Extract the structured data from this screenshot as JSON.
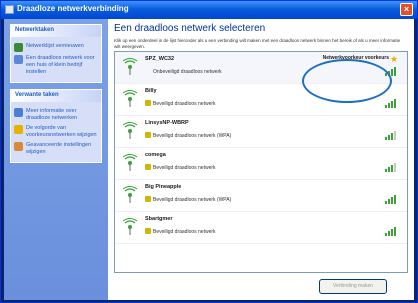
{
  "window": {
    "title": "Draadloze netwerkverbinding",
    "close_label": "×"
  },
  "sidebar": {
    "sections": [
      {
        "heading": "Netwerktaken",
        "items": [
          {
            "label": "Netwerklijst vernieuwen",
            "icon": "refresh-icon"
          },
          {
            "label": "Een draadloos netwerk voor een huis of klein bedrijf instellen",
            "icon": "setup-wireless-icon"
          }
        ]
      },
      {
        "heading": "Verwante taken",
        "items": [
          {
            "label": "Meer informatie over draadloze netwerken",
            "icon": "info-icon"
          },
          {
            "label": "De volgorde van voorkeursnetwerken wijzigen",
            "icon": "star-order-icon"
          },
          {
            "label": "Geavanceerde instellingen wijzigen",
            "icon": "advanced-settings-icon"
          }
        ]
      }
    ]
  },
  "main": {
    "title": "Een draadloos netwerk selecteren",
    "description": "Klik op een onderdeel in de lijst hieronder als u een verbinding wilt maken met een draadloos netwerk binnen het bereik of als u meer informatie wilt weergeven.",
    "networks": [
      {
        "name": "SPZ_WC32",
        "status": "Onbeveiligd draadloos netwerk",
        "secured": false,
        "preferred": true,
        "preferred_label": "Netwerkvoorkeur voorkeurs",
        "signal": 4
      },
      {
        "name": "Billy",
        "status": "Beveiligd draadloos netwerk",
        "secured": true,
        "preferred": false,
        "signal": 4
      },
      {
        "name": "LinsysNP-WBRP",
        "status": "Beveiligd draadloos netwerk (WPA)",
        "secured": true,
        "preferred": false,
        "signal": 3
      },
      {
        "name": "comega",
        "status": "Beveiligd draadloos netwerk",
        "secured": true,
        "preferred": false,
        "signal": 3
      },
      {
        "name": "Big Pineapple",
        "status": "Beveiligd draadloos netwerk (WPA)",
        "secured": true,
        "preferred": false,
        "signal": 4
      },
      {
        "name": "Sbartgmer",
        "status": "Beveiligd draadloos netwerk",
        "secured": true,
        "preferred": false,
        "signal": 4
      }
    ],
    "connect_label": "Verbinding maken"
  },
  "colors": {
    "title_bar": "#0a5cdc",
    "sidebar": "#7ba2e7",
    "link": "#215dc6",
    "annotation": "#1e6fc2",
    "signal": "#3aa335"
  }
}
